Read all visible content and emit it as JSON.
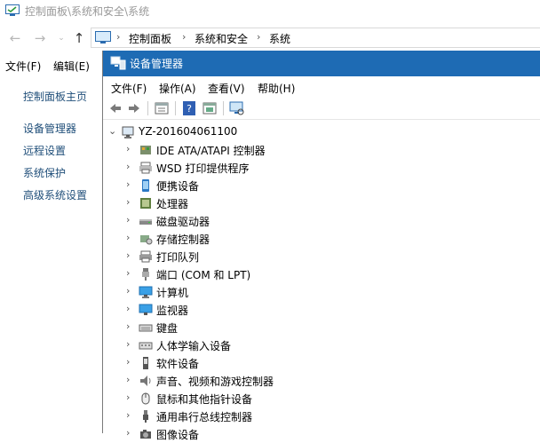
{
  "control_panel": {
    "window_title": "控制面板\\系统和安全\\系统",
    "breadcrumbs": [
      "控制面板",
      "系统和安全",
      "系统"
    ],
    "menu": [
      "文件(F)",
      "编辑(E)"
    ],
    "left_links": [
      "控制面板主页",
      "设备管理器",
      "远程设置",
      "系统保护",
      "高级系统设置"
    ]
  },
  "device_manager": {
    "title": "设备管理器",
    "menu": [
      "文件(F)",
      "操作(A)",
      "查看(V)",
      "帮助(H)"
    ],
    "toolbar_icons": [
      "back-icon",
      "forward-icon",
      "properties-icon",
      "help-icon",
      "show-hidden-icon",
      "scan-hardware-icon"
    ],
    "root": "YZ-201604061100",
    "categories": [
      {
        "label": "IDE ATA/ATAPI 控制器",
        "icon": "ide-controller-icon"
      },
      {
        "label": "WSD 打印提供程序",
        "icon": "wsd-printer-icon"
      },
      {
        "label": "便携设备",
        "icon": "portable-device-icon"
      },
      {
        "label": "处理器",
        "icon": "processor-icon"
      },
      {
        "label": "磁盘驱动器",
        "icon": "disk-drive-icon"
      },
      {
        "label": "存储控制器",
        "icon": "storage-controller-icon"
      },
      {
        "label": "打印队列",
        "icon": "print-queue-icon"
      },
      {
        "label": "端口 (COM 和 LPT)",
        "icon": "port-icon"
      },
      {
        "label": "计算机",
        "icon": "computer-icon"
      },
      {
        "label": "监视器",
        "icon": "monitor-icon"
      },
      {
        "label": "键盘",
        "icon": "keyboard-icon"
      },
      {
        "label": "人体学输入设备",
        "icon": "hid-icon"
      },
      {
        "label": "软件设备",
        "icon": "software-device-icon"
      },
      {
        "label": "声音、视频和游戏控制器",
        "icon": "sound-icon"
      },
      {
        "label": "鼠标和其他指针设备",
        "icon": "mouse-icon"
      },
      {
        "label": "通用串行总线控制器",
        "icon": "usb-icon"
      },
      {
        "label": "图像设备",
        "icon": "imaging-device-icon"
      }
    ]
  },
  "colors": {
    "titlebar_accent": "#1e6bb4",
    "link": "#1f4e79"
  }
}
